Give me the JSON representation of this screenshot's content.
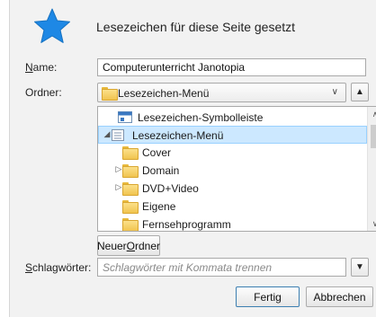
{
  "header": {
    "title": "Lesezeichen für diese Seite gesetzt"
  },
  "fields": {
    "name_label_underlined": "N",
    "name_label_rest": "ame:",
    "name_value": "Computerunterricht Janotopia",
    "folder_label": "Ordner:",
    "folder_value": "Lesezeichen-Menü",
    "tags_label_underlined": "S",
    "tags_label_rest": "chlagwörter:",
    "tags_placeholder": "Schlagwörter mit Kommata trennen"
  },
  "tree": {
    "items": [
      {
        "label": "Lesezeichen-Symbolleiste",
        "icon": "toolbar-icon",
        "twisty": ""
      },
      {
        "label": "Lesezeichen-Menü",
        "icon": "menu-icon",
        "twisty": "◢",
        "selected": true
      },
      {
        "label": "Cover",
        "icon": "folder-icon",
        "twisty": ""
      },
      {
        "label": "Domain",
        "icon": "folder-icon",
        "twisty": "▷"
      },
      {
        "label": "DVD+Video",
        "icon": "folder-icon",
        "twisty": "▷"
      },
      {
        "label": "Eigene",
        "icon": "folder-icon",
        "twisty": ""
      },
      {
        "label": "Fernsehprogramm",
        "icon": "folder-icon",
        "twisty": ""
      }
    ]
  },
  "buttons": {
    "new_folder_pre": "Neuer ",
    "new_folder_underlined": "O",
    "new_folder_post": "rdner",
    "done": "Fertig",
    "cancel": "Abbrechen",
    "collapse_glyph": "▲",
    "expand_glyph": "▼"
  },
  "colors": {
    "star": "#1e88e5",
    "selection": "#cce8ff"
  }
}
